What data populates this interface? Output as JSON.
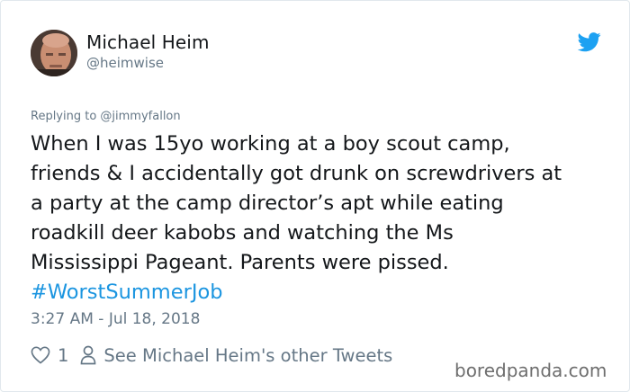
{
  "tweet": {
    "display_name": "Michael Heim",
    "handle": "@heimwise",
    "replying_to": "Replying to @jimmyfallon",
    "text_lines": [
      "When I was 15yo working at a boy scout camp,",
      "friends & I accidentally got drunk on screwdrivers at",
      "a party at the camp director’s apt while eating",
      "roadkill deer kabobs and watching the Ms",
      "Mississippi Pageant. Parents were pissed."
    ],
    "hashtag": "#WorstSummerJob",
    "timestamp": "3:27 AM - Jul 18, 2018",
    "like_count": "1",
    "other_tweets_link": "See Michael Heim's other Tweets"
  },
  "icons": {
    "platform": "twitter-bird-icon",
    "like": "heart-icon",
    "profile": "person-icon"
  },
  "colors": {
    "brand_blue": "#1da1f2",
    "hashtag": "#1b95e0",
    "secondary_text": "#657786",
    "primary_text": "#14171a"
  },
  "watermark": "boredpanda.com"
}
